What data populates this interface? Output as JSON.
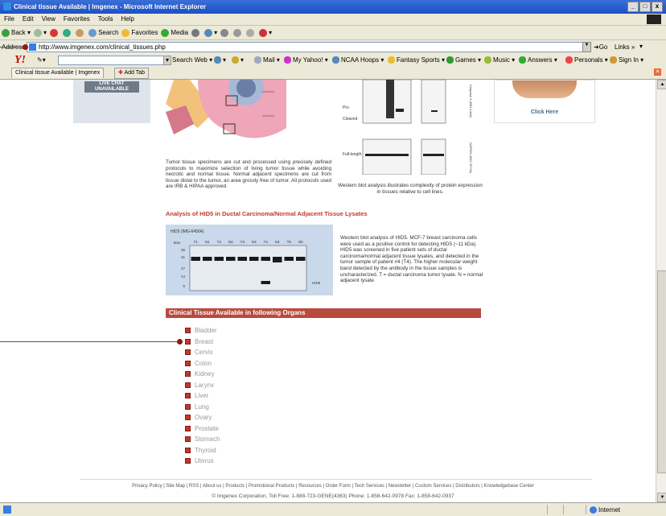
{
  "window": {
    "title": "Clinical tissue Available | Imgenex - Microsoft Internet Explorer",
    "controls": [
      "_",
      "□",
      "x"
    ]
  },
  "menu": [
    "File",
    "Edit",
    "View",
    "Favorites",
    "Tools",
    "Help"
  ],
  "toolbar": {
    "back": "Back",
    "search": "Search",
    "favorites": "Favorites",
    "media": "Media"
  },
  "address": {
    "label": "Address",
    "url": "http://www.imgenex.com/clinical_tissues.php",
    "go": "Go",
    "links": "Links"
  },
  "yahoo_bar": {
    "logo": "Y!",
    "search_web": "Search Web",
    "mail": "Mail",
    "my_yahoo": "My Yahoo!",
    "ncaa": "NCAA Hoops",
    "fantasy": "Fantasy Sports",
    "games": "Games",
    "music": "Music",
    "answers": "Answers",
    "personals": "Personals",
    "sign_in": "Sign In"
  },
  "tabs": {
    "active": "Clinical tissue Available | Imgenex",
    "add": "Add Tab"
  },
  "page": {
    "livechat": "LIVE CHAT UNAVAILABLE",
    "click_here": "Click Here",
    "caption_tissue": "Tumor tissue specimens are cut and processed using precisely defined protocols to maximize selection of living tumor tissue while avoiding necrotic and normal tissue. Normal adjacent specimens are cut from tissue distal to the tumor, an area grossly free of tumor. All protocols used are IRB & HIPAA approved",
    "caption_western": "Western blot analysis illustrates complexity of protein expression in tissues relative to cell lines.",
    "section_hids": "Analysis of HID5 in Ductal Carcinoma/Normal Adjacent Tissue Lysates",
    "caption_hids": "Western blot analysis of HID5. MCF-7 breast carcinoma cells were used as a positive control for detecting HID5 (~11 kDa). HID5 was screened in five patient sets of ductal carcinoma/normal adjacent tissue lysates, and detected in the tumor sample of patient #4 (T4). The higher molecular weight band detected by the antibody in the tissue samples is uncharacterized. T = ductal carcinoma tumor lysate. N = normal adjacent lysate",
    "organs_header": "Clinical Tissue Available in following Organs",
    "organs": [
      "Bladder",
      "Breast",
      "Cervix",
      "Colon",
      "Kidney",
      "Larynx",
      "Liver",
      "Lung",
      "Ovary",
      "Prostate",
      "Stomach",
      "Thyroid",
      "Uterus"
    ],
    "footer_links": "Privacy Policy | Site Map | RSS | About us | Products | Promotional Products | Resources | Order Form | Tech Services | Newsletter | Custom Services | Distributors | Knowledgebase Center",
    "copyright": "© Imgenex Corporation, Toll Free: 1-888-723-GENE(4363) Phone: 1-858-642-0978 Fax: 1-858-642-0937",
    "blot_labels": {
      "title": "HID5 (IMG-6456A)",
      "lanes": [
        "T1",
        "N1",
        "T2",
        "N2",
        "T3",
        "N3",
        "T4",
        "N4",
        "T5",
        "N5"
      ],
      "kda": "kDa",
      "markers": [
        "36",
        "21",
        "27",
        "14",
        "6"
      ],
      "band": "HID5"
    },
    "blot1_labels": {
      "left": [
        "Pro",
        "Cleaved",
        "Full-length"
      ],
      "right_top": "Caspase-3 (IMG-144A)",
      "right_bottom": "GAPDH (IMG-3073A)"
    }
  },
  "status": {
    "zone": "Internet"
  }
}
